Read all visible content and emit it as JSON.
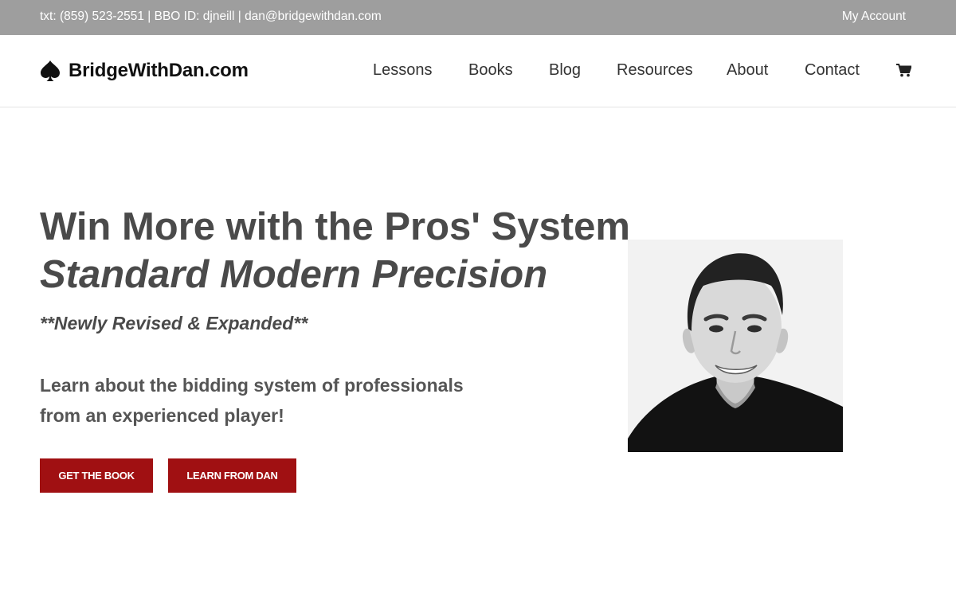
{
  "topbar": {
    "phone": "txt: (859) 523-2551",
    "separator": " | ",
    "bbo": "BBO ID: djneill",
    "email": "dan@bridgewithdan.com",
    "account": "My Account",
    "background_color": "#9e9e9e"
  },
  "header": {
    "logo_icon": "spade-icon",
    "logo_text": "BridgeWithDan.com",
    "nav": [
      "Lessons",
      "Books",
      "Blog",
      "Resources",
      "About",
      "Contact"
    ],
    "cart_icon": "cart-icon"
  },
  "hero": {
    "title_line1": "Win More with the Pros' System",
    "title_line2": "Standard Modern Precision",
    "subtitle": "**Newly Revised & Expanded**",
    "description_line1": "Learn about the bidding system of professionals",
    "description_line2": "from an experienced player!",
    "buttons": [
      "GET THE BOOK",
      "LEARN FROM DAN"
    ],
    "button_color": "#a01012",
    "image": "portrait-photo"
  }
}
